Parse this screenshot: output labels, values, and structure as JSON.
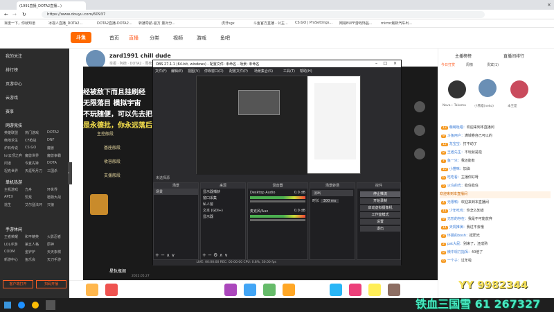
{
  "browser": {
    "tabs": [
      "(1991直播_DOTA2直播...)"
    ],
    "url": "https://www.douyu.com/60937",
    "bookmarks": [
      "百度一下，你就知道",
      "冰视人直播_DOTA2...",
      "DOTA2直播-DOTA2...",
      "转播导航-官方 量对分...",
      "虎牙sgx",
      "斗鱼官方直播 - 公主...",
      "CS:GO | ProSettings...",
      "网易BUFF游戏饰品...",
      "mirror最新汽车出..."
    ]
  },
  "site": {
    "logo": "斗鱼",
    "nav": [
      "首页",
      "直播",
      "分类",
      "视频",
      "游戏",
      "鱼吧"
    ]
  },
  "sidebar": {
    "items": [
      "我的关注",
      "排行榜",
      "页游中心",
      "云游戏",
      "赛事"
    ],
    "sections": [
      "网游竞技",
      "单机热游",
      "手游休闲"
    ],
    "grid_rows": [
      [
        "英雄联盟",
        "热门游戏",
        "DOTA2"
      ],
      [
        "绝地求生",
        "CF枪战",
        "DNF"
      ],
      [
        "炉石传说",
        "CS:GO",
        "魔兽"
      ],
      [
        "lol云顶之弈",
        "魔兽世界",
        "魔兽争霸"
      ],
      [
        "问道",
        "今夏先锋",
        "DOTA"
      ],
      [
        "坦克世界",
        "天涯明月刀",
        "三国杀"
      ]
    ],
    "grid_rows2": [
      [
        "主机游戏",
        "方舟",
        "环世界"
      ],
      [
        "APEX",
        "饥荒",
        "植物大战"
      ],
      [
        "逃生",
        "艾尔登法环",
        "只狼"
      ]
    ],
    "grid_rows3": [
      [
        "王者荣耀",
        "和平精英",
        "火影忍者"
      ],
      [
        "LOL手游",
        "第五人格",
        "原神"
      ],
      [
        "CODM",
        "金铲铲",
        "天天象棋"
      ],
      [
        "新游中心",
        "鱼乐会",
        "天刀手游"
      ]
    ],
    "bottom_buttons": [
      "客户端打开",
      "扫码开播"
    ]
  },
  "room": {
    "title": "zard1991 chill dude",
    "streamer": "zard1991",
    "subtitle": "举报 · 阿德 · DOTA2 · 周榜单",
    "overlay_lines": [
      "经被敌下而且挂刷经",
      "无限落目 模拟宇宙",
      "不玩随便，可以先去把",
      "是永德批，你永远落后"
    ],
    "menu": [
      "主控般段",
      "基座般段",
      "收容般段",
      "支援般段"
    ],
    "video_tag": "星轨瓶阁",
    "bottom_info": "2022.05.27"
  },
  "obs": {
    "title": "OBS 27.1.1 (64-bit, windows) - 配置文件: 未命名 - 场景: 未命名",
    "menu": [
      "文件(F)",
      "编辑(E)",
      "视图(V)",
      "停靠窗口(D)",
      "配置文件(P)",
      "场景集合(S)",
      "工具(T)",
      "帮助(H)"
    ],
    "no_source": "未选择源",
    "docks": {
      "scenes": {
        "header": "场景",
        "items": [
          "场景"
        ]
      },
      "sources": {
        "header": "来源",
        "items": [
          "显示器捕获",
          "窗口采集",
          "私人窗",
          "文本 (GDI+)",
          "显示器"
        ]
      },
      "mixer": {
        "header": "混音器",
        "tracks": [
          {
            "name": "Desktop Audio",
            "db": "0.0 dB"
          },
          {
            "name": "麦克风/Aux",
            "db": "0.0 dB"
          }
        ]
      },
      "transitions": {
        "header": "场景转场",
        "fade": "淡出",
        "duration_label": "时长",
        "duration": "300 ms"
      },
      "controls": {
        "header": "控件",
        "buttons": [
          "停止推流",
          "开始录制",
          "启动虚拟摄像机",
          "工作室模式",
          "设置",
          "退出"
        ]
      }
    },
    "status": "LIVE: 00:00:00   REC: 00:00:00   CPU: 0.8%, 30.00 fps"
  },
  "chat": {
    "tabs": [
      "主播榜榜",
      "直播间排行"
    ],
    "subtabs": [
      "今日打赏",
      "周榜",
      "贵宾(1)"
    ],
    "top_users": [
      "Nova~ Takama",
      "小熊喵(neko)",
      "本王是"
    ],
    "messages": [
      {
        "user": "萌萌哒喵：",
        "text": "欢迎来到本直播间"
      },
      {
        "user": "斗鱼用户：",
        "text": "满城卷自己可以的"
      },
      {
        "user": "龙宝宝：",
        "text": "打不动了"
      },
      {
        "user": "王者先生：",
        "text": "不玩就是啦"
      },
      {
        "user": "鱼一只：",
        "text": "我还能有"
      },
      {
        "user": "小猫咪：",
        "text": "加油"
      },
      {
        "user": "吃吃看：",
        "text": "主播你好呀"
      },
      {
        "user": "火鸟的光：",
        "text": "稳住稳住"
      },
      {
        "user": "无限鸭：",
        "text": "欢迎来到本直播间"
      },
      {
        "user": "少年吃鸡：",
        "text": "你怎么知道"
      },
      {
        "user": "无形的存在：",
        "text": "我是不可能放弃"
      },
      {
        "user": "天机推演：",
        "text": "我过不去哦"
      },
      {
        "user": "环晨的bosh：",
        "text": "挺阳光"
      },
      {
        "user": "pat大屁：",
        "text": "别来了，还成熟"
      },
      {
        "user": "微中现刀指挥：",
        "text": "40倍了"
      },
      {
        "user": "一个子：",
        "text": "过年啦"
      }
    ],
    "enter_notice": "欢迎来到本直播间"
  },
  "overlay": {
    "yy_number": "YY 9982344",
    "footer_title": "铁血三国雪 61 267327"
  }
}
